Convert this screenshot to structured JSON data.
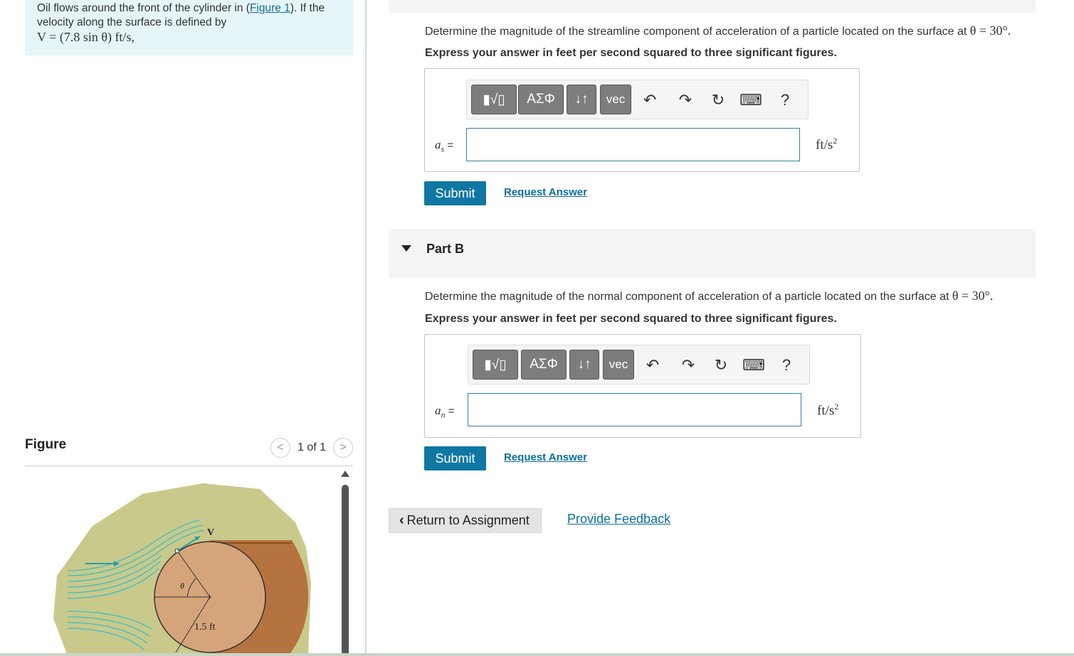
{
  "problem": {
    "text_before": "Oil flows around the front of the cylinder in (",
    "figure_link": "Figure 1",
    "text_after": "). If the velocity along the surface is defined by",
    "equation": "V = (7.8 sin θ) ft/s,"
  },
  "figure": {
    "title": "Figure",
    "pager": "1 of 1",
    "prev_glyph": "<",
    "next_glyph": ">",
    "label_v": "V",
    "label_theta": "θ",
    "label_radius": "1.5 ft"
  },
  "part_a": {
    "question": "Determine the magnitude of the streamline component of acceleration of a particle located on the surface at",
    "math": "θ = 30°.",
    "instruction": "Express your answer in feet per second squared to three significant figures.",
    "var": "a",
    "var_sub": "s",
    "equals": "=",
    "unit": "ft/s",
    "unit_exp": "2",
    "submit": "Submit",
    "request": "Request Answer"
  },
  "part_b": {
    "title": "Part B",
    "question": "Determine the magnitude of the normal component of acceleration of a particle located on the surface at",
    "math": "θ = 30°.",
    "instruction": "Express your answer in feet per second squared to three significant figures.",
    "var": "a",
    "var_sub": "n",
    "equals": "=",
    "unit": "ft/s",
    "unit_exp": "2",
    "submit": "Submit",
    "request": "Request Answer"
  },
  "toolbar": {
    "template_glyph": "▮√▯",
    "greek": "ΑΣΦ",
    "arrows": "↓↑",
    "vec": "vec",
    "undo": "↶",
    "redo": "↷",
    "reset": "↻",
    "keyboard": "⌨",
    "help": "?"
  },
  "footer": {
    "return": "Return to Assignment",
    "return_glyph": "‹",
    "feedback": "Provide Feedback"
  },
  "colors": {
    "accent": "#0f77a2",
    "link": "#0a6f9c",
    "problem_bg": "#e6f5f7",
    "cylinder": "#d6a47a",
    "rock": "#c9c98c",
    "stream": "#3bbfc4"
  }
}
